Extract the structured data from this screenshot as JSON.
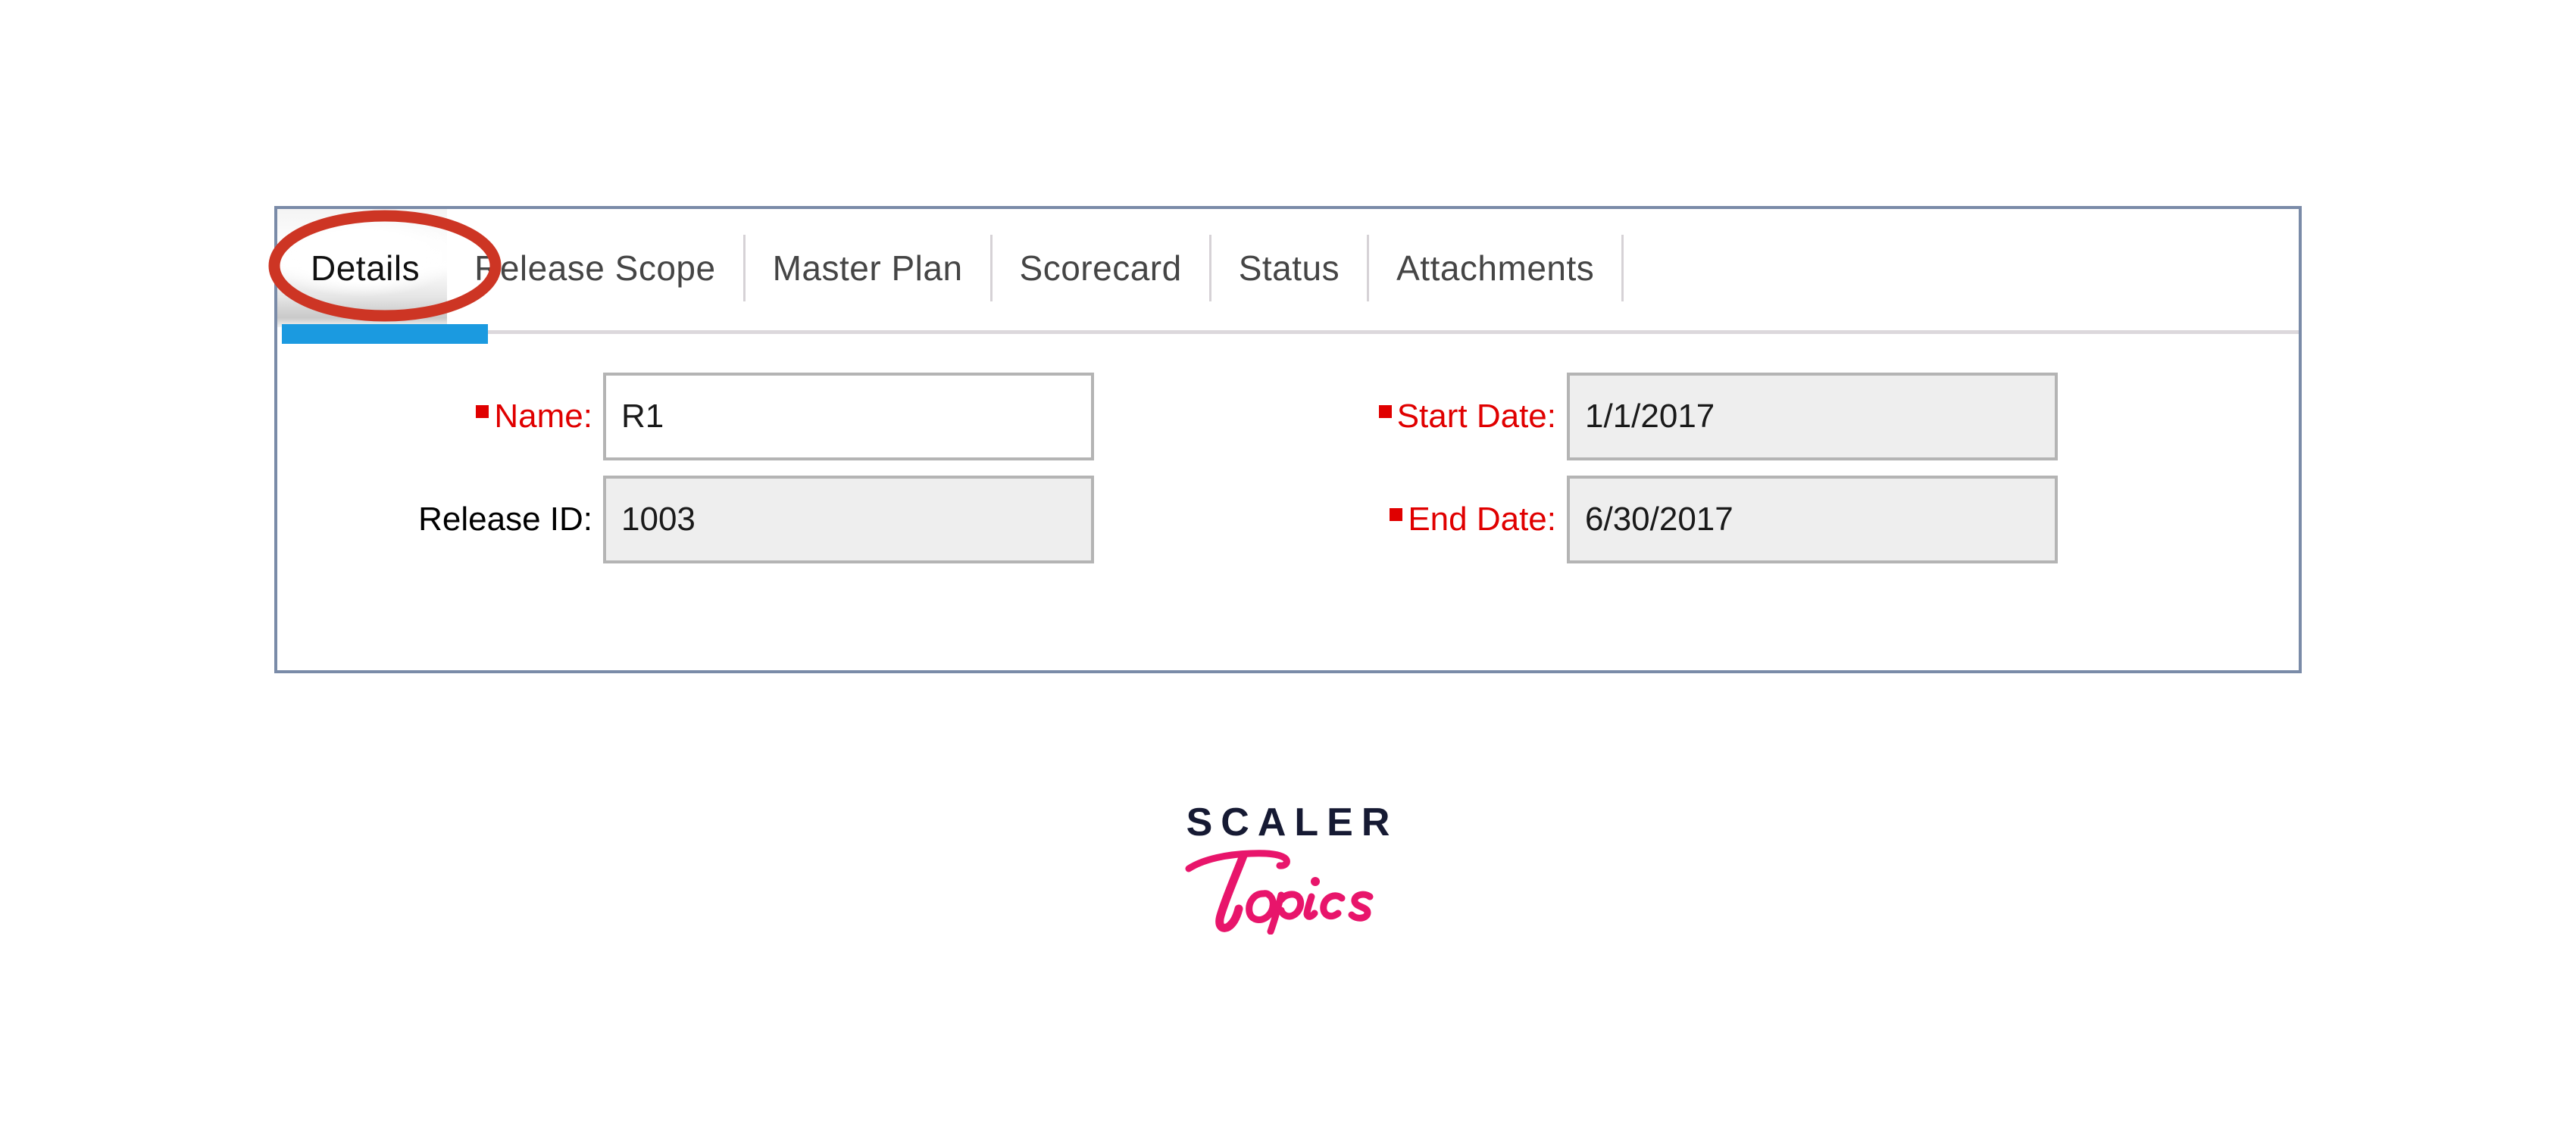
{
  "panel": {
    "tabs": [
      {
        "id": "details",
        "label": "Details",
        "active": true,
        "separator_after": false
      },
      {
        "id": "release-scope",
        "label": "Release Scope",
        "active": false,
        "separator_after": true
      },
      {
        "id": "master-plan",
        "label": "Master Plan",
        "active": false,
        "separator_after": true
      },
      {
        "id": "scorecard",
        "label": "Scorecard",
        "active": false,
        "separator_after": true
      },
      {
        "id": "status",
        "label": "Status",
        "active": false,
        "separator_after": true
      },
      {
        "id": "attachments",
        "label": "Attachments",
        "active": false,
        "separator_after": true
      }
    ],
    "form": {
      "fields": [
        {
          "id": "name",
          "label": "Name:",
          "required": true,
          "value": "R1",
          "readonly": false
        },
        {
          "id": "release-id",
          "label": "Release ID:",
          "required": false,
          "value": "1003",
          "readonly": true
        },
        {
          "id": "start-date",
          "label": "Start Date:",
          "required": true,
          "value": "1/1/2017",
          "readonly": true
        },
        {
          "id": "end-date",
          "label": "End Date:",
          "required": true,
          "value": "6/30/2017",
          "readonly": true
        }
      ]
    }
  },
  "annotation": {
    "target_tab": "Details",
    "shape": "ellipse",
    "color": "#cd3524"
  },
  "logo": {
    "primary": "SCALER",
    "secondary": "Topics",
    "primary_color": "#161a33",
    "secondary_color": "#e8156b"
  },
  "colors": {
    "panel_border": "#7a8ba8",
    "active_tab_underline": "#1b9ae0",
    "required_label": "#e00000",
    "tab_label": "#454545",
    "field_border": "#b4b4b4",
    "readonly_field_bg": "#eeeeee"
  }
}
